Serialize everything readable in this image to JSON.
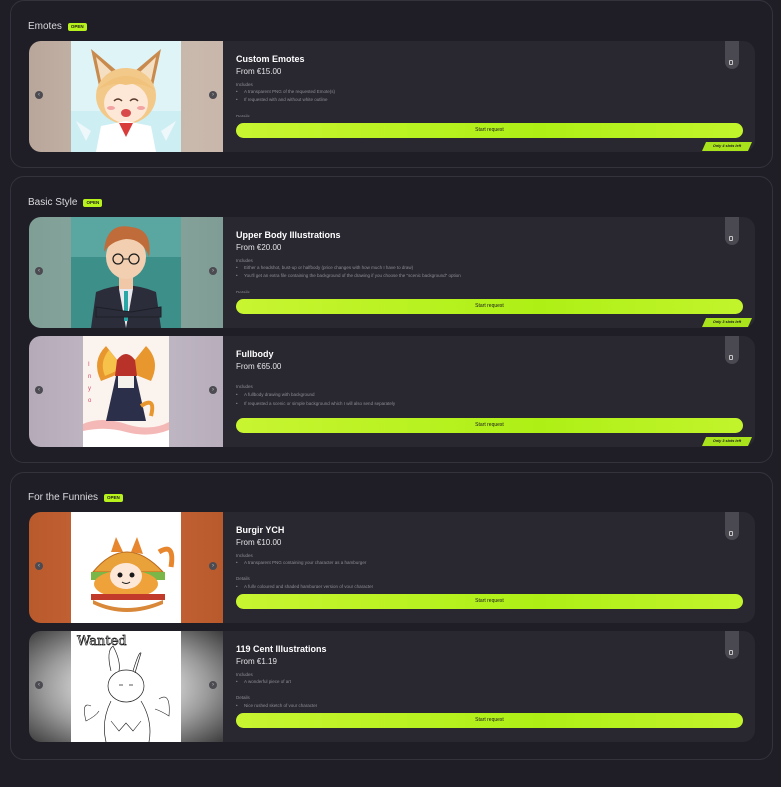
{
  "sections": [
    {
      "title": "Emotes",
      "badge": "OPEN",
      "cards": [
        {
          "title": "Custom Emotes",
          "price": "From €15.00",
          "includes_label": "Includes",
          "includes": [
            "A transparent PNG of the requested Emote(s)",
            "If requested with and without white outline"
          ],
          "details_label": "Details",
          "button": "Start request",
          "ribbon": "Only 4 slots left"
        }
      ]
    },
    {
      "title": "Basic Style",
      "badge": "OPEN",
      "cards": [
        {
          "title": "Upper Body Illustrations",
          "price": "From €20.00",
          "includes_label": "Includes",
          "includes": [
            "Either a headshot, bust-up or halfbody (price changes with how much I have to draw)",
            "You'll get an extra file containing the background of the drawing if you choose the \"scenic background\" option"
          ],
          "details_label": "Details",
          "button": "Start request",
          "ribbon": "Only 3 slots left"
        },
        {
          "title": "Fullbody",
          "price": "From €65.00",
          "includes_label": "Includes",
          "includes": [
            "A fullbody drawing with background",
            "If requested a scenic or simple background which I will also send separately"
          ],
          "button": "Start request",
          "ribbon": "Only 3 slots left"
        }
      ]
    },
    {
      "title": "For the Funnies",
      "badge": "OPEN",
      "cards": [
        {
          "title": "Burgir YCH",
          "price": "From €10.00",
          "includes_label": "Includes",
          "includes": [
            "A transparent PNG containing your character as a hamburger"
          ],
          "details_label": "Details",
          "details": [
            "A fully coloured and shaded hamburger version of your character"
          ],
          "button": "Start request"
        },
        {
          "title": "119 Cent Illustrations",
          "price": "From €1.19",
          "includes_label": "Includes",
          "includes": [
            "A wonderful piece of art"
          ],
          "details_label": "Details",
          "details": [
            "Nice rushed sketch of your character"
          ],
          "button": "Start request",
          "image_text": "Wanted"
        }
      ]
    }
  ],
  "colors": {
    "accent": "#b8f21c",
    "background": "#1f1e26",
    "card": "#292831"
  },
  "icons": {
    "prev": "chevron-left-icon",
    "next": "chevron-right-icon",
    "tab": "bookmark-icon"
  }
}
